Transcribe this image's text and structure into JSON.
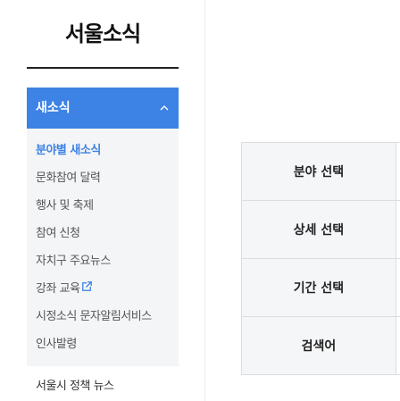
{
  "lnb": {
    "title": "서울소식",
    "header": "새소식",
    "items": [
      {
        "label": "분야별 새소식",
        "active": true
      },
      {
        "label": "문화참여 달력",
        "active": false
      },
      {
        "label": "행사 및 축제",
        "active": false
      },
      {
        "label": "참여 신청",
        "active": false
      },
      {
        "label": "자치구 주요뉴스",
        "active": false
      },
      {
        "label": "강좌 교육",
        "active": false,
        "external": true
      },
      {
        "label": "시정소식 문자알림서비스",
        "active": false
      },
      {
        "label": "인사발령",
        "active": false
      }
    ],
    "other_item": "서울시 정책 뉴스"
  },
  "search": {
    "rows": [
      {
        "label": "분야 선택"
      },
      {
        "label": "상세 선택"
      },
      {
        "label": "기간 선택"
      },
      {
        "label": "검색어"
      }
    ]
  },
  "colors": {
    "accent": "#3d82e5",
    "submenu_bg": "#f4f5f7",
    "table_header_bg": "#f5f6f8",
    "border": "#dddddd"
  },
  "icons": {
    "header_toggle": "chevron-up-icon",
    "external": "external-link-icon"
  }
}
